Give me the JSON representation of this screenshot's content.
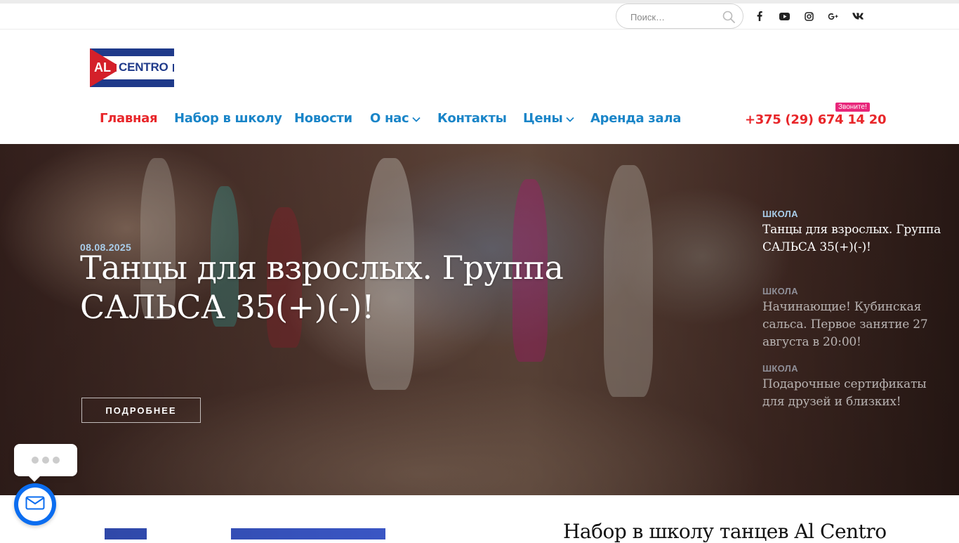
{
  "search": {
    "placeholder": "Поиск…"
  },
  "social": [
    "facebook-icon",
    "youtube-icon",
    "instagram-icon",
    "google-plus-icon",
    "vk-icon"
  ],
  "logo": {
    "text_al": "AL",
    "text_centro": "CENTRO",
    "colors": {
      "blue": "#1f3a8a",
      "red": "#d4202a",
      "white": "#ffffff"
    }
  },
  "nav": {
    "items": [
      {
        "label": "Главная",
        "active": true
      },
      {
        "label": "Набор в школу"
      },
      {
        "label": "Новости"
      },
      {
        "label": "О нас",
        "dropdown": true
      },
      {
        "label": "Контакты"
      },
      {
        "label": "Цены",
        "dropdown": true
      },
      {
        "label": "Аренда зала"
      }
    ],
    "phone": "+375 (29) 674 14 20",
    "phone_badge": "Звоните!"
  },
  "hero": {
    "date": "08.08.2025",
    "title": "Танцы для взрослых. Группа САЛЬСА 35(+)(-)!",
    "button": "ПОДРОБНЕЕ",
    "side": [
      {
        "category": "ШКОЛА",
        "title": "Танцы для взрослых. Группа САЛЬСА 35(+)(-)!"
      },
      {
        "category": "ШКОЛА",
        "title": "Начинающие! Кубинская сальса. Первое занятие 27 августа в 20:00!"
      },
      {
        "category": "ШКОЛА",
        "title": "Подарочные сертификаты для друзей и близких!"
      }
    ]
  },
  "section": {
    "title": "Набор в школу танцев Al Centro"
  },
  "colors": {
    "accent_blue": "#1a85c8",
    "accent_red": "#e8262a",
    "badge_pink": "#e8267a",
    "chat_blue": "#0b6df0"
  }
}
